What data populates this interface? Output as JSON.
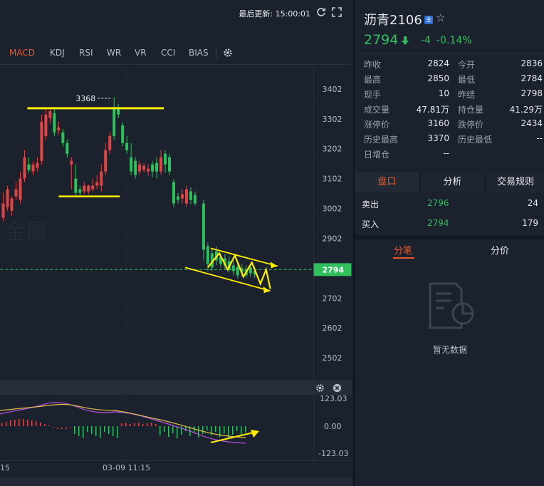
{
  "topbar": {
    "last_update": "最后更新: 15:00:01"
  },
  "indicators": [
    "MACD",
    "KDJ",
    "RSI",
    "WR",
    "VR",
    "CCI",
    "BIAS"
  ],
  "active_indicator": "MACD",
  "main_chart": {
    "price_labels": [
      "3402",
      "3302",
      "3202",
      "3102",
      "3002",
      "2902",
      "2702",
      "2602",
      "2502"
    ],
    "current_price_tag": "2794",
    "high_marker": "3368",
    "watermark": "金屬"
  },
  "sub_chart": {
    "labels": [
      "123.03",
      "0.00",
      "-123.03"
    ]
  },
  "x_axis": {
    "labels": [
      "15",
      "03-09 11:15"
    ]
  },
  "info": {
    "name": "沥青2106",
    "badge": "主",
    "price": "2794",
    "change": "-4",
    "change_pct": "-0.14%",
    "stats": [
      {
        "l1": "昨收",
        "v1": "2824",
        "l2": "今开",
        "v2": "2836"
      },
      {
        "l1": "最高",
        "v1": "2850",
        "l2": "最低",
        "v2": "2784"
      },
      {
        "l1": "现手",
        "v1": "10",
        "l2": "昨结",
        "v2": "2798"
      },
      {
        "l1": "成交量",
        "v1": "47.81万",
        "l2": "持仓量",
        "v2": "41.29万"
      },
      {
        "l1": "涨停价",
        "v1": "3160",
        "l2": "跌停价",
        "v2": "2434"
      },
      {
        "l1": "历史最高",
        "v1": "3370",
        "l2": "历史最低",
        "v2": "--"
      },
      {
        "l1": "日增仓",
        "v1": "--",
        "l2": "",
        "v2": ""
      }
    ],
    "trade_tabs": [
      "盘口",
      "分析",
      "交易规则"
    ],
    "book": [
      {
        "label": "卖出",
        "price": "2796",
        "vol": "24"
      },
      {
        "label": "买入",
        "price": "2794",
        "vol": "179"
      }
    ],
    "detail_tabs": [
      "分笔",
      "分价"
    ],
    "empty_text": "暂无数据"
  },
  "colors": {
    "up": "#e04545",
    "down": "#2fbf5c",
    "accent": "#e85a2e",
    "annotation": "#ffee00"
  }
}
